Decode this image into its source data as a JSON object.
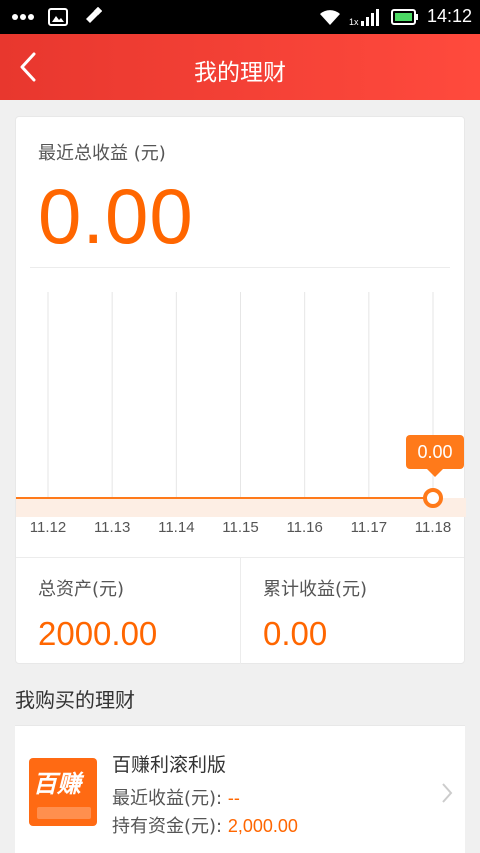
{
  "status_bar": {
    "time": "14:12",
    "network_label": "1x"
  },
  "header": {
    "title": "我的理财"
  },
  "summary": {
    "recent_label": "最近总收益 (元)",
    "recent_value": "0.00"
  },
  "chart_data": {
    "type": "line",
    "x": [
      "11.12",
      "11.13",
      "11.14",
      "11.15",
      "11.16",
      "11.17",
      "11.18"
    ],
    "series": [
      {
        "values": [
          0,
          0,
          0,
          0,
          0,
          0,
          0
        ]
      }
    ],
    "highlight": {
      "x": "11.18",
      "label": "0.00"
    },
    "line_color": "#ff7a1a",
    "grid": true
  },
  "stats": {
    "total_assets_label": "总资产(元)",
    "total_assets_value": "2000.00",
    "cumulative_label": "累计收益(元)",
    "cumulative_value": "0.00"
  },
  "section": {
    "title": "我购买的理财"
  },
  "product": {
    "name": "百赚利滚利版",
    "recent_label": "最近收益(元): ",
    "recent_value": "--",
    "holding_label": "持有资金(元): ",
    "holding_value": "2,000.00",
    "logo_text": "百赚"
  },
  "colors": {
    "accent": "#ff6600",
    "header": "#e8372e"
  }
}
